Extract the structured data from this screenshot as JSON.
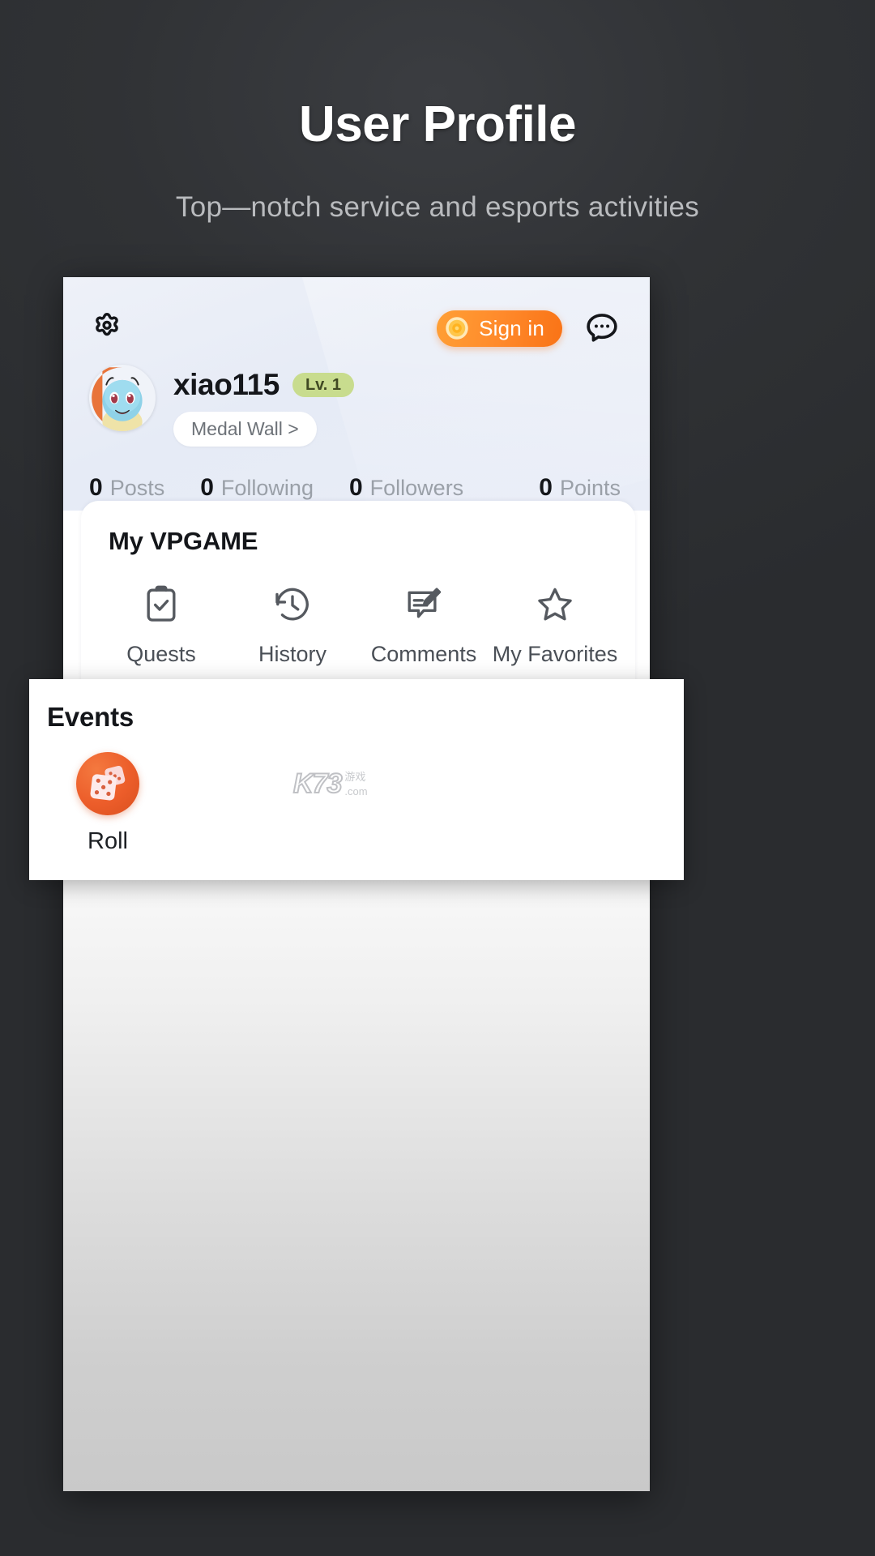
{
  "promo": {
    "title": "User Profile",
    "subtitle": "Top—notch service and esports activities"
  },
  "app": {
    "header": {
      "settings_icon": "gear-icon",
      "signin_label": "Sign in",
      "signin_icon": "coin-icon",
      "chat_icon": "chat-bubble-icon",
      "accent_color": "#f97316"
    },
    "profile": {
      "avatar_icon": "squirtle-avatar",
      "username": "xiao115",
      "level_badge": "Lv. 1",
      "level_badge_color": "#c8dc8e",
      "medal_wall_label": "Medal Wall >"
    },
    "stats": [
      {
        "value": "0",
        "label": "Posts"
      },
      {
        "value": "0",
        "label": "Following"
      },
      {
        "value": "0",
        "label": "Followers"
      },
      {
        "value": "0",
        "label": "Points"
      }
    ],
    "my_vpgame": {
      "title": "My VPGAME",
      "items": [
        {
          "label": "Quests",
          "icon": "clipboard-check-icon"
        },
        {
          "label": "History",
          "icon": "clock-history-icon"
        },
        {
          "label": "Comments",
          "icon": "comment-edit-icon"
        },
        {
          "label": "My Favorites",
          "icon": "star-icon"
        }
      ]
    },
    "events": {
      "title": "Events",
      "items": [
        {
          "label": "Roll",
          "icon": "dice-icon",
          "badge_color": "#ec5d2a"
        }
      ]
    }
  },
  "watermark": {
    "logo": "K73",
    "line1": "游戏",
    "line2": ".com"
  }
}
